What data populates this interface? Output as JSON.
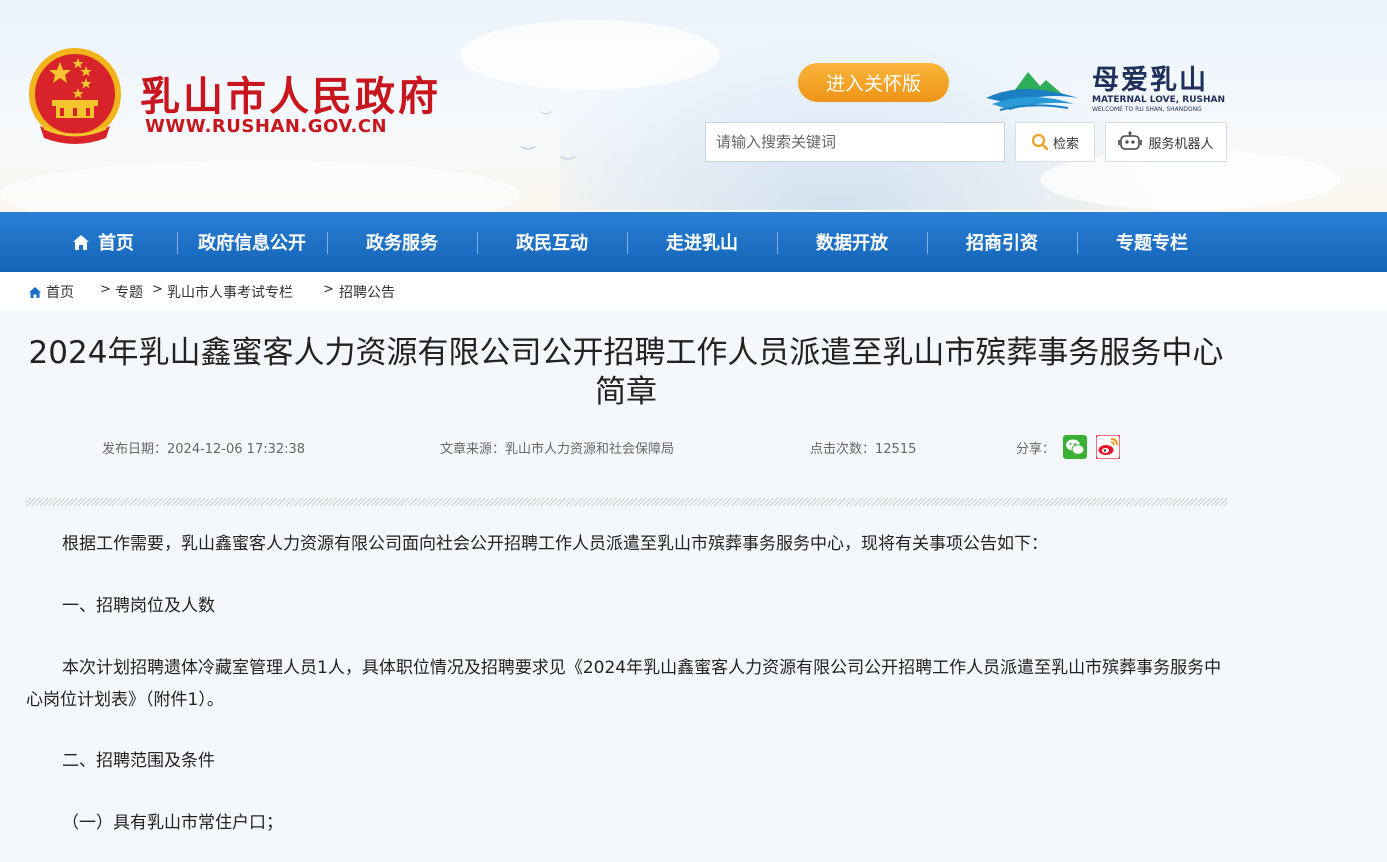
{
  "header": {
    "site_name": "乳山市人民政府",
    "site_url": "WWW.RUSHAN.GOV.CN",
    "care_button": "进入关怀版",
    "brand_cn": "母爱乳山",
    "brand_en": "MATERNAL LOVE, RUSHAN",
    "brand_en_sub": "WELCOME TO RU SHAN, SHANDONG",
    "search_placeholder": "请输入搜索关键词",
    "search_button": "检索",
    "robot_button": "服务机器人"
  },
  "nav": {
    "items": [
      "首页",
      "政府信息公开",
      "政务服务",
      "政民互动",
      "走进乳山",
      "数据开放",
      "招商引资",
      "专题专栏"
    ]
  },
  "breadcrumb": {
    "items": [
      "首页",
      "专题",
      "乳山市人事考试专栏",
      "招聘公告"
    ],
    "separator": ">"
  },
  "article": {
    "title": "2024年乳山鑫蜜客人力资源有限公司公开招聘工作人员派遣至乳山市殡葬事务服务中心简章",
    "publish_date": "发布日期：2024-12-06 17:32:38",
    "source": "文章来源：乳山市人力资源和社会保障局",
    "views": "点击次数：12515",
    "share_label": "分享：",
    "paragraphs": [
      "根据工作需要，乳山鑫蜜客人力资源有限公司面向社会公开招聘工作人员派遣至乳山市殡葬事务服务中心，现将有关事项公告如下：",
      "一、招聘岗位及人数",
      "本次计划招聘遗体冷藏室管理人员1人，具体职位情况及招聘要求见《2024年乳山鑫蜜客人力资源有限公司公开招聘工作人员派遣至乳山市殡葬事务服务中心岗位计划表》（附件1）。",
      "二、招聘范围及条件",
      "（一）具有乳山市常住户口；"
    ]
  },
  "colors": {
    "brand_red": "#c8161e",
    "nav_blue": "#1a6fc4",
    "care_orange": "#f0a020"
  }
}
